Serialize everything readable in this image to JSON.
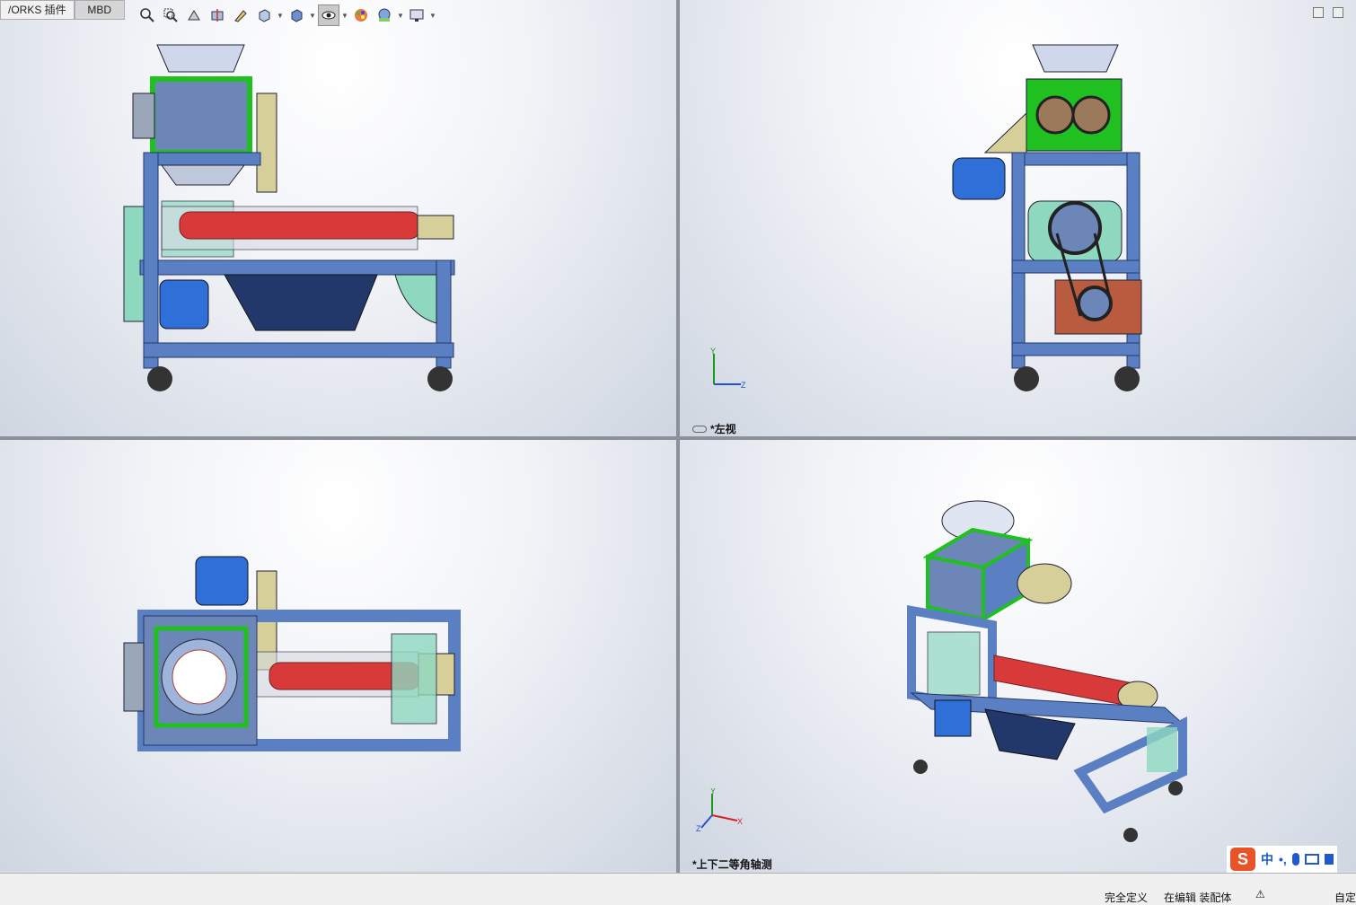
{
  "tabs": [
    {
      "label": "/ORKS 插件"
    },
    {
      "label": "MBD"
    }
  ],
  "toolbar": {
    "tools": [
      "zoom-to-fit-icon",
      "zoom-area-icon",
      "previous-view-icon",
      "section-view-icon",
      "dynamic-annotation-icon",
      "view-orientation-icon",
      "display-style-icon",
      "hide-show-items-icon",
      "edit-appearance-icon",
      "apply-scene-icon",
      "view-settings-icon"
    ]
  },
  "viewports": [
    {
      "id": "front",
      "label": ""
    },
    {
      "id": "left",
      "label": "*左视"
    },
    {
      "id": "top",
      "label": ""
    },
    {
      "id": "iso",
      "label": "*上下二等角轴测"
    }
  ],
  "triad": {
    "x": "X",
    "y": "Y",
    "z": "Z"
  },
  "status": {
    "defined": "完全定义",
    "editing": "在编辑 装配体",
    "custom": "自定"
  },
  "ime": {
    "lang": "中",
    "punct": "•,"
  },
  "colors": {
    "frame": "#5a7fc2",
    "frame_dark": "#23386a",
    "box_green": "#1fc01f",
    "housing": "#6d86b8",
    "screw": "#d83a3a",
    "tan": "#d7cf9a",
    "motor": "#2f6fd8",
    "gear_brown": "#b85b3e",
    "glass": "#8fd8c0"
  }
}
